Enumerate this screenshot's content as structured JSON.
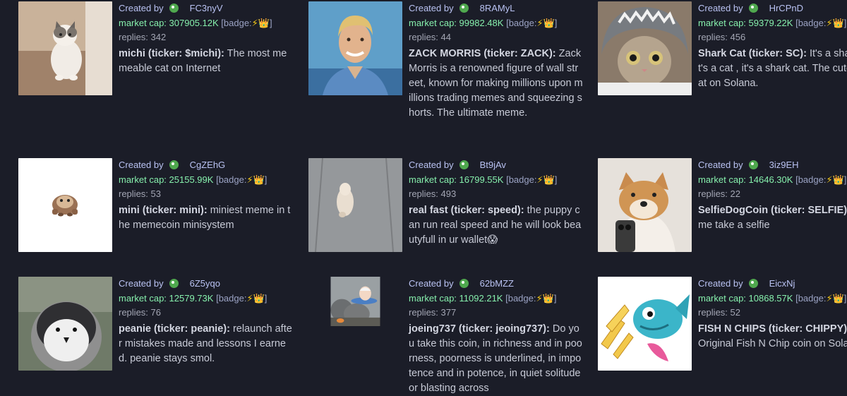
{
  "ui": {
    "created_by": "Created by",
    "market_cap_prefix": "market cap:",
    "badge_label": "[badge:",
    "badge_close": "]",
    "replies_prefix": "replies:",
    "bolt_icon": "⚡",
    "crown_icon": "👑"
  },
  "cards": [
    {
      "creator": "FC3nyV",
      "market_cap": "307905.12K",
      "replies": "342",
      "name": "michi (ticker: $michi):",
      "description": "The most memeable cat on Internet",
      "image_icon": "cat-photo"
    },
    {
      "creator": "8RAMyL",
      "market_cap": "99982.48K",
      "replies": "44",
      "name": "ZACK MORRIS (ticker: ZACK):",
      "description": "Zack Morris is a renowned figure of wall street, known for making millions upon millions trading memes and squeezing shorts. The ultimate meme.",
      "image_icon": "person-photo"
    },
    {
      "creator": "HrCPnD",
      "market_cap": "59379.22K",
      "replies": "456",
      "name": "Shark Cat (ticker: SC):",
      "description": "It's a shark , it's a cat , it's a shark cat. The cutest cat on Solana.",
      "image_icon": "shark-cat-photo"
    },
    {
      "creator": "CgZEhG",
      "market_cap": "25155.99K",
      "replies": "53",
      "name": "mini (ticker: mini):",
      "description": "miniest meme in the memecoin minisystem",
      "image_icon": "mini-hamster-photo"
    },
    {
      "creator": "Bt9jAv",
      "market_cap": "16799.55K",
      "replies": "493",
      "name": "real fast (ticker: speed):",
      "description": "the puppy can run real speed and he will look beautyfull in ur wallet😱",
      "image_icon": "puppy-photo"
    },
    {
      "creator": "3iz9EH",
      "market_cap": "14646.30K",
      "replies": "22",
      "name": "SelfieDogCoin (ticker: SELFIE):",
      "description": "Some take a selfie",
      "image_icon": "selfie-dog-photo"
    },
    {
      "creator": "6Z5yqo",
      "market_cap": "12579.73K",
      "replies": "76",
      "name": "peanie (ticker: peanie):",
      "description": "relaunch after mistakes made and lessons I earned. peanie stays smol.",
      "image_icon": "penguin-photo"
    },
    {
      "creator": "62bMZZ",
      "market_cap": "11092.21K",
      "replies": "377",
      "name": "joeing737 (ticker: jeoing737):",
      "description": "Do you take this coin, in richness and in poorness, poorness is underlined, in impotence and in potence, in quiet solitude or blasting across",
      "image_icon": "plane-photo"
    },
    {
      "creator": "EicxNj",
      "market_cap": "10868.57K",
      "replies": "52",
      "name": "FISH N CHIPS (ticker: CHIPPY):",
      "description": "The Original Fish N Chip coin on Solana",
      "image_icon": "fish-chips-photo"
    }
  ]
}
